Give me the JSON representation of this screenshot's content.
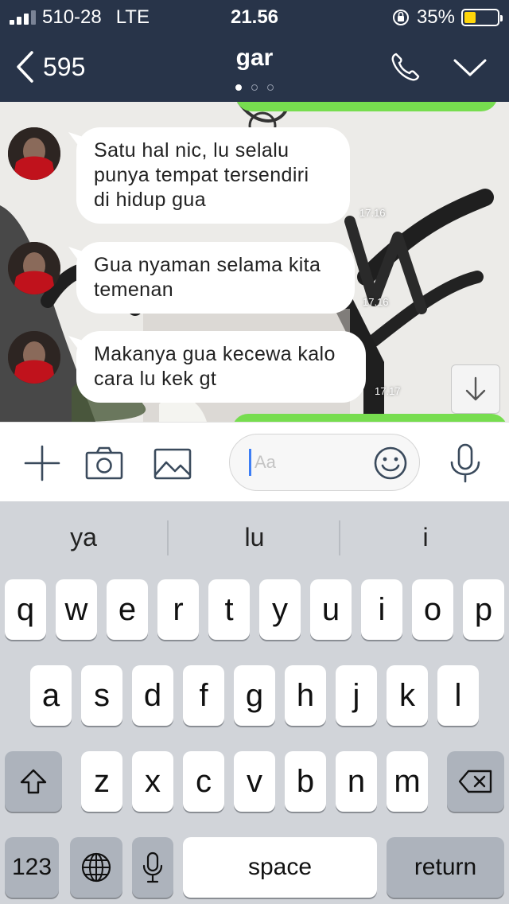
{
  "status_bar": {
    "carrier": "510-28",
    "network": "LTE",
    "time": "21.56",
    "battery_percent": "35%",
    "battery_level": 0.35
  },
  "header": {
    "back_count": "595",
    "title": "gar",
    "page_dots": 3,
    "active_dot": 0
  },
  "messages": [
    {
      "text_lines": [
        "Satu hal nic, lu selalu",
        "punya tempat tersendiri",
        "di hidup gua"
      ],
      "time": "17.16"
    },
    {
      "text_lines": [
        "Gua nyaman selama kita",
        "temenan"
      ],
      "time": "17.16"
    },
    {
      "text_lines": [
        "Makanya gua kecewa kalo",
        "cara lu kek gt"
      ],
      "time": "17.17"
    }
  ],
  "input_bar": {
    "placeholder": "Aa",
    "icons": [
      "plus-icon",
      "camera-icon",
      "image-icon",
      "emoji-icon",
      "microphone-icon"
    ]
  },
  "keyboard": {
    "suggestions": [
      "ya",
      "lu",
      "i"
    ],
    "row1": [
      "q",
      "w",
      "e",
      "r",
      "t",
      "y",
      "u",
      "i",
      "o",
      "p"
    ],
    "row2": [
      "a",
      "s",
      "d",
      "f",
      "g",
      "h",
      "j",
      "k",
      "l"
    ],
    "row3": [
      "z",
      "x",
      "c",
      "v",
      "b",
      "n",
      "m"
    ],
    "numbers_label": "123",
    "space_label": "space",
    "return_label": "return"
  },
  "colors": {
    "header_bg": "#283449",
    "sent_bubble": "#77dd4f",
    "received_bubble": "#ffffff",
    "battery": "#ffd60a",
    "keyboard_bg": "#d1d4d9"
  }
}
